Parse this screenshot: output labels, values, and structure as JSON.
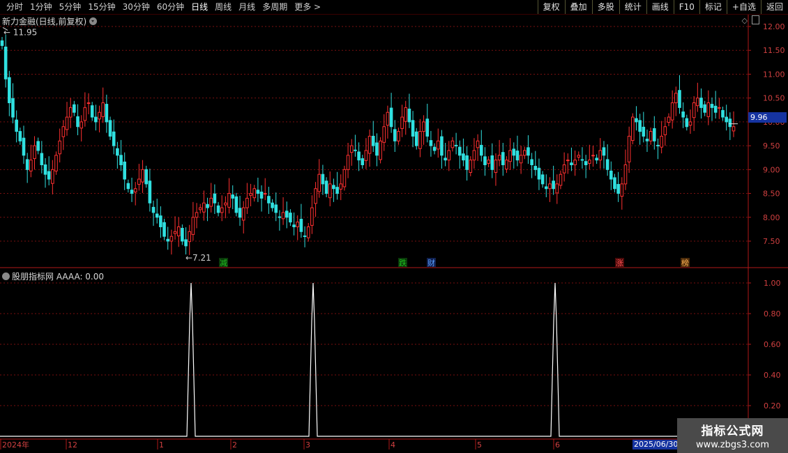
{
  "toolbar": {
    "periods": [
      "分时",
      "1分钟",
      "5分钟",
      "15分钟",
      "30分钟",
      "60分钟",
      "日线",
      "周线",
      "月线",
      "多周期",
      "更多 >"
    ],
    "active_period": "日线",
    "actions": [
      "复权",
      "叠加",
      "多股",
      "统计",
      "画线",
      "F10",
      "标记",
      "+自选",
      "返回"
    ]
  },
  "kline": {
    "title": "新力金融(日线,前复权)",
    "high_label": "11.95",
    "low_label": "7.21",
    "current_price": "9.96",
    "yticks": [
      "12.00",
      "11.50",
      "11.00",
      "10.50",
      "10.00",
      "9.50",
      "9.00",
      "8.50",
      "8.00",
      "7.50"
    ],
    "ytick_values": [
      12.0,
      11.5,
      11.0,
      10.5,
      10.0,
      9.5,
      9.0,
      8.5,
      8.0,
      7.5
    ],
    "events": [
      {
        "label": "减",
        "color": "#20c020",
        "bg": "#0a3a0a"
      },
      {
        "label": "跌",
        "color": "#20c020",
        "bg": "#0a3a0a"
      },
      {
        "label": "财",
        "color": "#5aa0ff",
        "bg": "#102050"
      },
      {
        "label": "涨",
        "color": "#ff5050",
        "bg": "#4a0a0a"
      },
      {
        "label": "榜",
        "color": "#ffb050",
        "bg": "#4a2a0a"
      }
    ],
    "up_color": "#ff3030",
    "down_color": "#30e0e0"
  },
  "indicator": {
    "title": "股朋指标网 AAAA: 0.00",
    "yticks": [
      "1.00",
      "0.80",
      "0.60",
      "0.40",
      "0.20"
    ],
    "ytick_values": [
      1.0,
      0.8,
      0.6,
      0.4,
      0.2
    ],
    "line_color": "#ffffff"
  },
  "xaxis": {
    "labels": [
      "2024年",
      "12",
      "1",
      "2",
      "3",
      "4",
      "5",
      "6"
    ],
    "current_date": "2025/06/30/"
  },
  "watermark": {
    "title": "指标公式网",
    "url": "www.zbgs3.com"
  }
}
